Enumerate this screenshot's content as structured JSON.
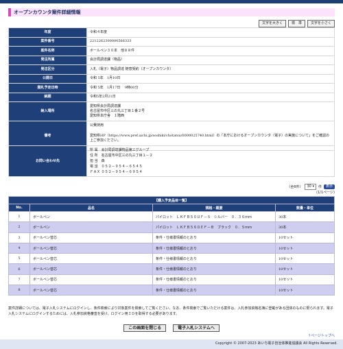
{
  "page": {
    "title": "オープンカウンタ案件詳細情報"
  },
  "font_buttons": [
    "文字を大きく",
    "標　準",
    "文字を小さく"
  ],
  "info_rows": [
    {
      "label": "年度",
      "value": "令和４年度"
    },
    {
      "label": "案件番号",
      "value": "2212262300000566333"
    },
    {
      "label": "案件名称",
      "value": "ボールペン３０本　他８８件"
    },
    {
      "label": "発注所属",
      "value": "会計局調達課（物品）"
    },
    {
      "label": "発注区分",
      "value": "入札（電子）物品調達 随意契約（オープンカウンタ）"
    },
    {
      "label": "公開日",
      "value": "令和 5年　1月10日"
    },
    {
      "label": "開札予定日時",
      "value": "令和 5年　1月17日　 9時00分"
    },
    {
      "label": "納期",
      "value": "令和5年2月21日"
    }
  ],
  "delivery": {
    "label": "納入場所",
    "lines": [
      "愛知県会計局調達課",
      "名古屋市中区三の丸三丁目１番２号",
      "愛知県本庁舎　１階西"
    ]
  },
  "remarks": {
    "label": "備考",
    "lines": [
      "公費持用",
      "愛知県HP（https://www.pref.aichi.jp/soshiki/chotatsu/0000025740.html）の「本庁におけるオープンカウンタ（電子）の実施について」をご確認の上ご参加ください。"
    ]
  },
  "contact": {
    "label": "お問い合わせ先",
    "lines": [
      "所 属　会計局調達課物品第三グループ",
      "住 所　名古屋市中区三の丸三丁目１－２",
      "担 当　森",
      "電 話　０５２－９５４－６５４５",
      "ＦＡＸ ０５２－９５４－６９５４"
    ]
  },
  "pager": {
    "count_label": "（全8件）",
    "per_page": "30",
    "per_page_suffix": "件",
    "go_label": "表示",
    "page_label": "(1/1ページ)"
  },
  "goods": {
    "caption": "【購入予定品目一覧】",
    "columns": [
      "No.",
      "品名",
      "規格・概要",
      "数量・単位"
    ],
    "rows": [
      {
        "no": "1",
        "name": "ボールペン",
        "spec": "パイロット　ＬＫＦＢ５０ＵＦ－Ｓ　シルバー　０．３６ｍｍ",
        "qty": "30本"
      },
      {
        "no": "2",
        "name": "ボールペン",
        "spec": "パイロット　ＬＫＦＢ５６０ＥＦ－Ｂ　ブラック　０．５ｍｍ",
        "qty": "30本"
      },
      {
        "no": "3",
        "name": "ボールペン替芯",
        "spec": "条件・仕様書情報のとおり",
        "qty": "10セット"
      },
      {
        "no": "4",
        "name": "ボールペン替芯",
        "spec": "条件・仕様書情報のとおり",
        "qty": "10セット"
      },
      {
        "no": "5",
        "name": "ボールペン替芯",
        "spec": "条件・仕様書情報のとおり",
        "qty": "10セット"
      },
      {
        "no": "6",
        "name": "ボールペン替芯",
        "spec": "条件・仕様書情報のとおり",
        "qty": "10セット"
      },
      {
        "no": "7",
        "name": "ボールペン替芯",
        "spec": "条件・仕様書情報のとおり",
        "qty": "10セット"
      },
      {
        "no": "8",
        "name": "ボールペン替芯",
        "spec": "条件・仕様書情報のとおり",
        "qty": "10セット"
      }
    ]
  },
  "note": "案件詳細については、電子入札システムにログインし、条件検索により対象案件を検索してご覧ください。なお、条件検索でご覧いただける案件は、入札参加資格名簿に登載がある団体のものに限られます。電子入札システムにログインするためには、入札参加資格審査を受け、ログイン用ＩＤを取得する必要があります。",
  "buttons": {
    "close": "この画面を閉じる",
    "system": "電子入札システムへ"
  },
  "to_top": "↑ページトップへ",
  "footer": "Copyright © 2007-2023 あいち電子自治体推進協議会 All Rights Reserved.",
  "colors": {
    "header_bg": "#1f3f78",
    "title_accent": "#d34bb8",
    "row_alt": "#cfcdf0"
  }
}
